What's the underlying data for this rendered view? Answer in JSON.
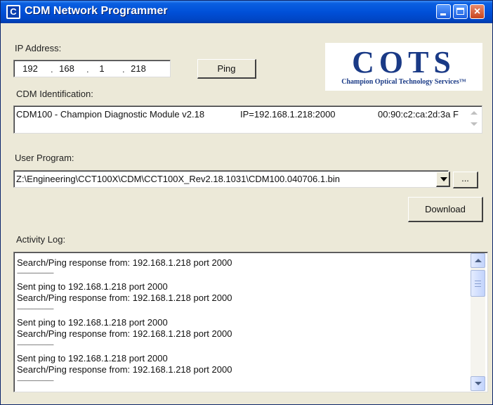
{
  "window": {
    "title": "CDM Network Programmer",
    "app_icon_glyph": "C",
    "controls": {
      "close_glyph": "×"
    }
  },
  "ip": {
    "label": "IP Address:",
    "octets": [
      "192",
      "168",
      "1",
      "218"
    ],
    "ping_label": "Ping"
  },
  "logo": {
    "text": "COTS",
    "subtitle": "Champion Optical Technology Services™",
    "color": "#1a3a86"
  },
  "cdm_id": {
    "label": "CDM Identification:",
    "module": "CDM100 - Champion Diagnostic Module v2.18",
    "address": "IP=192.168.1.218:2000",
    "mac": "00:90:c2:ca:2d:3a F"
  },
  "user_program": {
    "label": "User Program:",
    "path": "Z:\\Engineering\\CCT100X\\CDM\\CCT100X_Rev2.18.1031\\CDM100.040706.1.bin",
    "browse_label": "...",
    "download_label": "Download"
  },
  "activity_log": {
    "label": "Activity Log:",
    "lines": [
      "Search/Ping response from: 192.168.1.218 port 2000",
      "--------------------------",
      "Sent ping to 192.168.1.218 port 2000",
      "Search/Ping response from: 192.168.1.218 port 2000",
      "--------------------------",
      "Sent ping to 192.168.1.218 port 2000",
      "Search/Ping response from: 192.168.1.218 port 2000",
      "--------------------------",
      "Sent ping to 192.168.1.218 port 2000",
      "Search/Ping response from: 192.168.1.218 port 2000",
      "--------------------------"
    ]
  },
  "colors": {
    "titlebar": "#0050d8",
    "window_face": "#ece9d8",
    "text": "#111111"
  }
}
